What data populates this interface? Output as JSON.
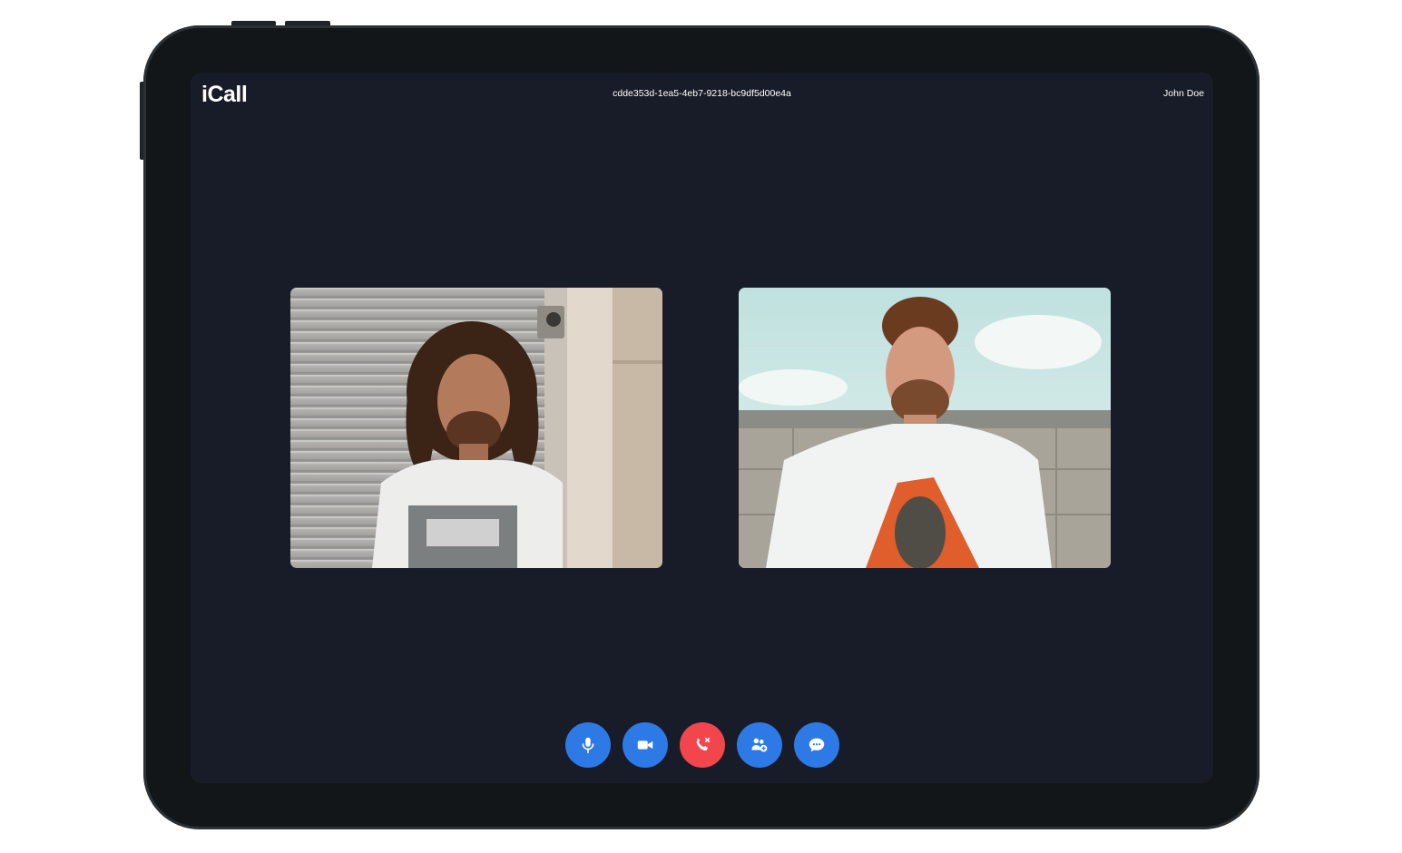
{
  "header": {
    "app_name": "iCall",
    "call_id": "cdde353d-1ea5-4eb7-9218-bc9df5d00e4a",
    "user_name": "John Doe"
  },
  "participants": [
    {
      "video": "participant-video-1"
    },
    {
      "video": "participant-video-2"
    }
  ],
  "controls": [
    {
      "name": "mute-button",
      "icon": "microphone-icon",
      "color": "#2d7ae6"
    },
    {
      "name": "camera-button",
      "icon": "video-camera-icon",
      "color": "#2d7ae6"
    },
    {
      "name": "end-call-button",
      "icon": "phone-hangup-icon",
      "color": "#f2464c"
    },
    {
      "name": "add-participant-button",
      "icon": "add-user-icon",
      "color": "#2d7ae6"
    },
    {
      "name": "chat-button",
      "icon": "chat-bubble-icon",
      "color": "#2d7ae6"
    }
  ],
  "theme": {
    "screen_bg": "#181c28",
    "frame": "#121619",
    "accent": "#2d7ae6",
    "danger": "#f2464c"
  }
}
